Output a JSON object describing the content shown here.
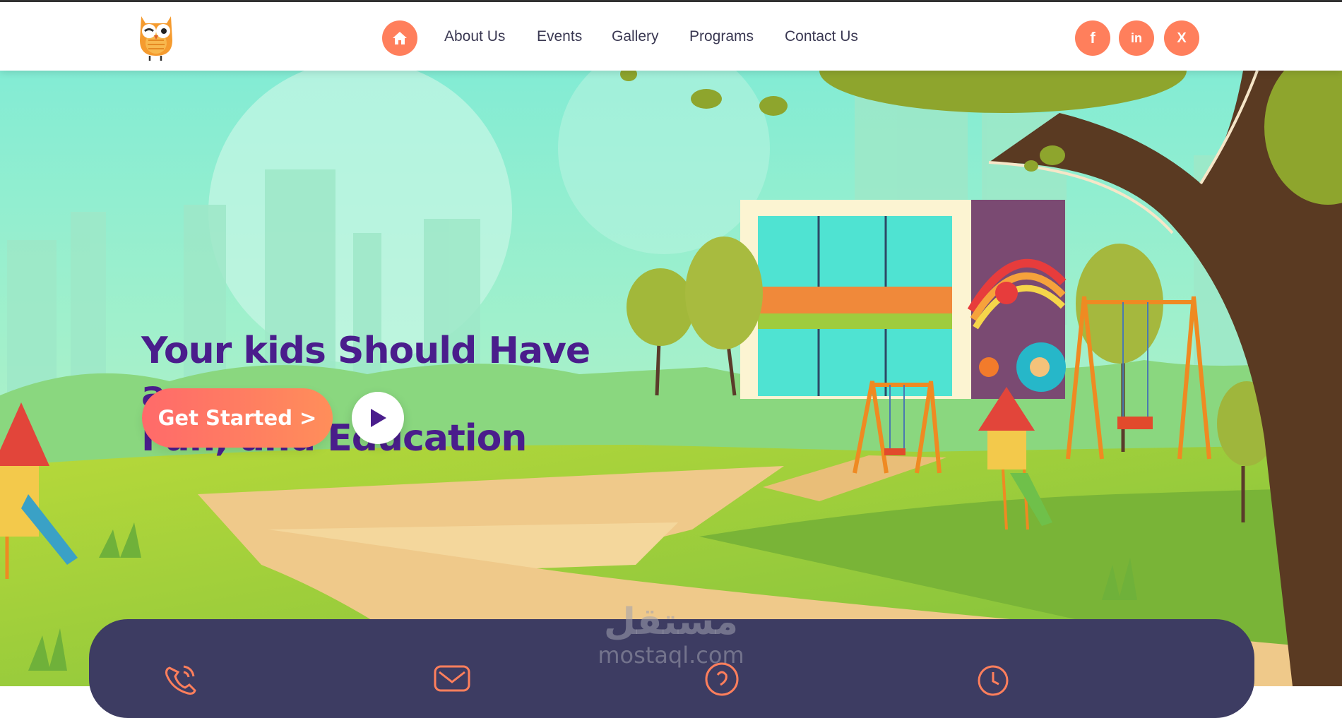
{
  "header": {
    "logo_icon": "owl-logo-icon",
    "home_icon": "home-icon",
    "nav": [
      {
        "label": "About Us"
      },
      {
        "label": "Events"
      },
      {
        "label": "Gallery"
      },
      {
        "label": "Programs"
      },
      {
        "label": "Contact Us"
      }
    ],
    "social": [
      {
        "icon": "facebook-icon",
        "glyph": "f"
      },
      {
        "icon": "linkedin-icon",
        "glyph": "in"
      },
      {
        "icon": "x-icon",
        "glyph": "X"
      }
    ]
  },
  "hero": {
    "headline_line1": "Your kids Should Have a",
    "headline_line2": "Fun, and Education",
    "cta_label": "Get Started >",
    "play_icon": "play-icon"
  },
  "info_bar": {
    "icons": [
      "phone-icon",
      "mail-icon",
      "location-icon",
      "clock-icon"
    ]
  },
  "watermark": {
    "arabic": "مستقل",
    "latin": "mostaql.com"
  },
  "colors": {
    "accent": "#ff7f5c",
    "headline": "#4a1d8c",
    "nav_text": "#3a3852",
    "info_bar": "#3d3c62",
    "sky": "#9df0d6",
    "grass": "#8fc63e",
    "path": "#efc98a"
  }
}
